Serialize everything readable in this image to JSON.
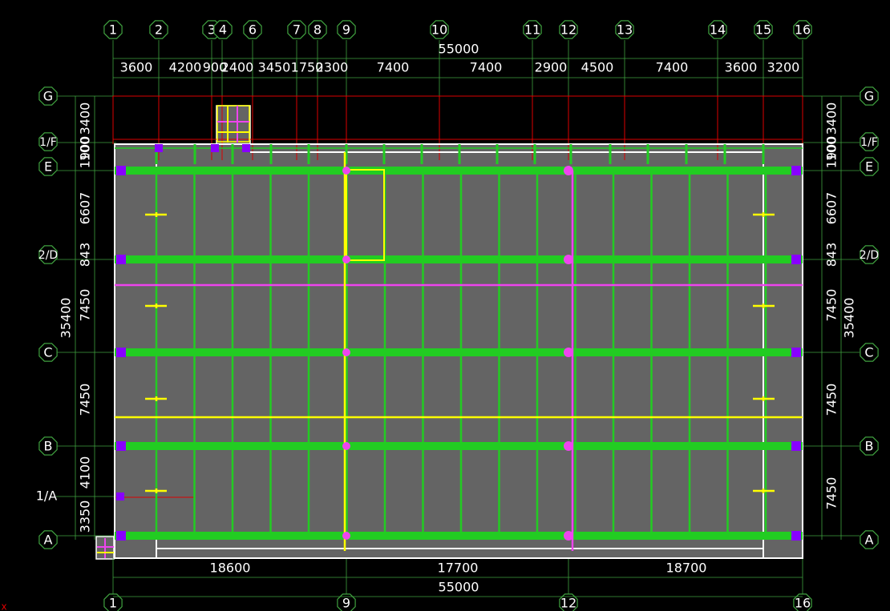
{
  "colors": {
    "background": "#000000",
    "grid_line": "#3fa03f",
    "beam": "#22cc22",
    "slab": "#646464",
    "wall": "#ffffff",
    "highlight": "#ffff00",
    "magenta": "#ee44ee",
    "column": "#8800ff",
    "axis_red": "#dd0000",
    "text": "#ffffff"
  },
  "axes": {
    "top_labels": [
      "1",
      "2",
      "3",
      "4",
      "6",
      "7",
      "8",
      "9",
      "10",
      "11",
      "12",
      "13",
      "14",
      "15",
      "16"
    ],
    "bottom_labels": [
      "1",
      "9",
      "12",
      "16"
    ],
    "left_labels": [
      "G",
      "1/F",
      "E",
      "2/D",
      "C",
      "B",
      "1/A",
      "A"
    ],
    "right_labels": [
      "G",
      "1/F",
      "E",
      "2/D",
      "C",
      "B",
      "A"
    ]
  },
  "dimensions": {
    "top_total": "55000",
    "top_segments": [
      "3600",
      "4200",
      "900",
      "2400",
      "3450",
      "1750",
      "2300",
      "7400",
      "7400",
      "2900",
      "4500",
      "7400",
      "3600",
      "3200"
    ],
    "bottom_total": "55000",
    "bottom_segments": [
      "18600",
      "17700",
      "18700"
    ],
    "left_total": "35400",
    "left_segments": [
      "3400",
      "1900",
      "100",
      "6607",
      "843",
      "7450",
      "7450",
      "4100",
      "3350"
    ],
    "right_total": "35400",
    "right_segments": [
      "3400",
      "1900",
      "100",
      "6607",
      "843",
      "7450",
      "7450",
      "7450"
    ]
  },
  "corner_mark": "x"
}
